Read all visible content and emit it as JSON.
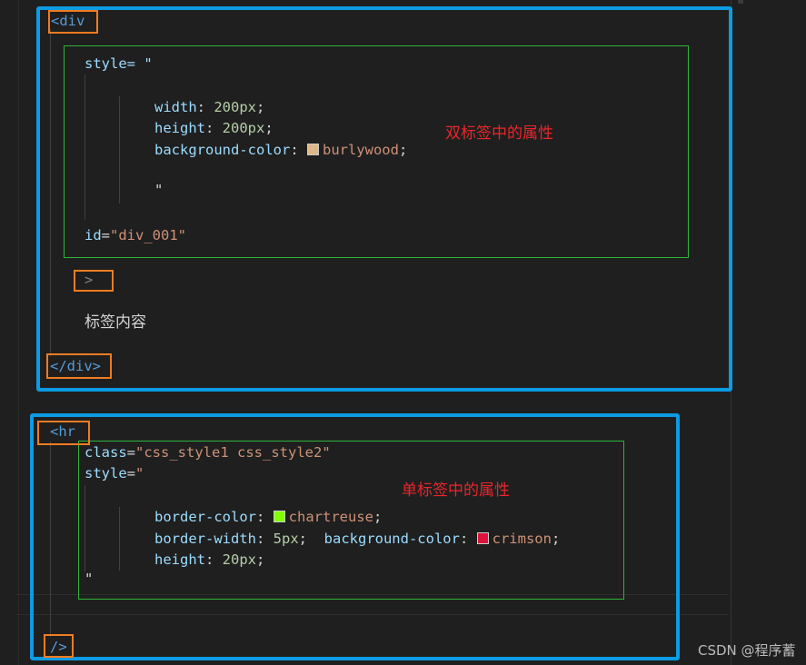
{
  "block1": {
    "open_tag": "<div",
    "style_line": "style= \"",
    "width_prop": "width",
    "width_val": "200px",
    "height_prop": "height",
    "height_val": "200px",
    "bg_prop": "background-color",
    "bg_val": "burlywood",
    "bg_color": "#deb887",
    "close_quote": "\"",
    "id_attr": "id",
    "id_val": "\"div_001\"",
    "gt": ">",
    "content": "标签内容",
    "close_tag": "</div>",
    "annotation": "双标签中的属性"
  },
  "block2": {
    "open_tag": "<hr",
    "class_attr": "class",
    "class_val": "\"css_style1 css_style2\"",
    "style_attr": "style",
    "style_open": "\"",
    "border_color_prop": "border-color",
    "border_color_val": "chartreuse",
    "border_color_swatch": "#7fff00",
    "border_width_prop": "border-width",
    "border_width_val": "5px",
    "bg_prop": "background-color",
    "bg_val": "crimson",
    "bg_swatch": "#dc143c",
    "height_prop": "height",
    "height_val": "20px",
    "close_quote": "\"",
    "self_close": "/>",
    "annotation": "单标签中的属性"
  },
  "watermark": "CSDN @程序蓄",
  "colors": {
    "highlight_blue": "#0d9be3",
    "highlight_green": "#2fb33a",
    "highlight_orange": "#f07c22",
    "annotation_red": "#e8262b"
  }
}
